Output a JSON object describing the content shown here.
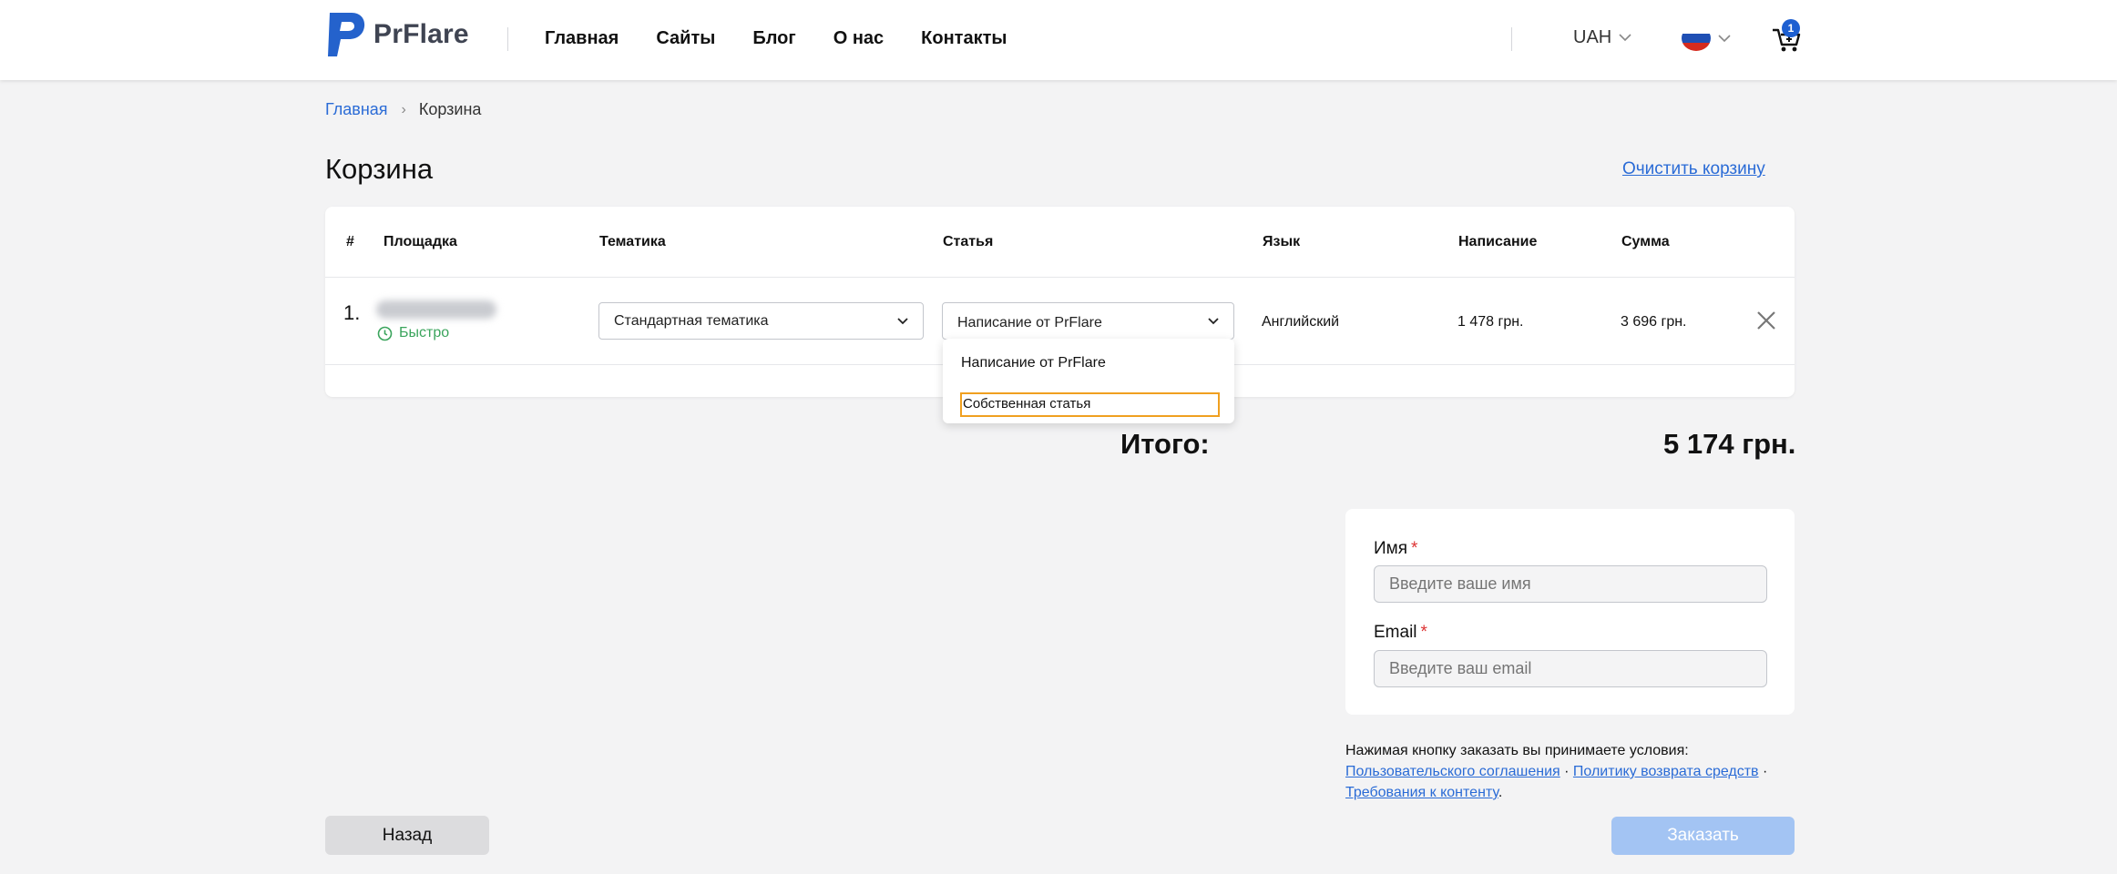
{
  "header": {
    "logo_text": "PrFlare",
    "nav": [
      "Главная",
      "Сайты",
      "Блог",
      "О нас",
      "Контакты"
    ],
    "currency": "UAH",
    "cart_count": "1"
  },
  "breadcrumb": {
    "home": "Главная",
    "current": "Корзина"
  },
  "page": {
    "title": "Корзина",
    "clear_cart": "Очистить корзину"
  },
  "table": {
    "headers": [
      "#",
      "Площадка",
      "Тематика",
      "Статья",
      "Язык",
      "Написание",
      "Сумма"
    ],
    "rows": [
      {
        "num": "1.",
        "speed": "Быстро",
        "topic": "Стандартная тематика",
        "article": "Написание от PrFlare",
        "language": "Английский",
        "writing": "1 478 грн.",
        "sum": "3 696 грн."
      }
    ]
  },
  "dropdown": {
    "options": [
      "Написание от PrFlare",
      "Собственная статья"
    ],
    "highlighted": "Собственная статья"
  },
  "total": {
    "label": "Итого:",
    "value": "5 174 грн."
  },
  "form": {
    "name_label": "Имя",
    "name_placeholder": "Введите ваше имя",
    "email_label": "Email",
    "email_placeholder": "Введите ваш email",
    "required_mark": "*"
  },
  "terms": {
    "intro": "Нажимая кнопку заказать вы принимаете условия:",
    "link1": "Пользовательского соглашения",
    "dot": " · ",
    "link2": "Политику возврата средств",
    "link3": "Требования к контенту",
    "end": "."
  },
  "buttons": {
    "back": "Назад",
    "order": "Заказать"
  },
  "colors": {
    "accent": "#2a6bd6",
    "brand": "#1d5fd1",
    "success": "#3aa45c",
    "order_disabled": "#a3c4f3"
  }
}
